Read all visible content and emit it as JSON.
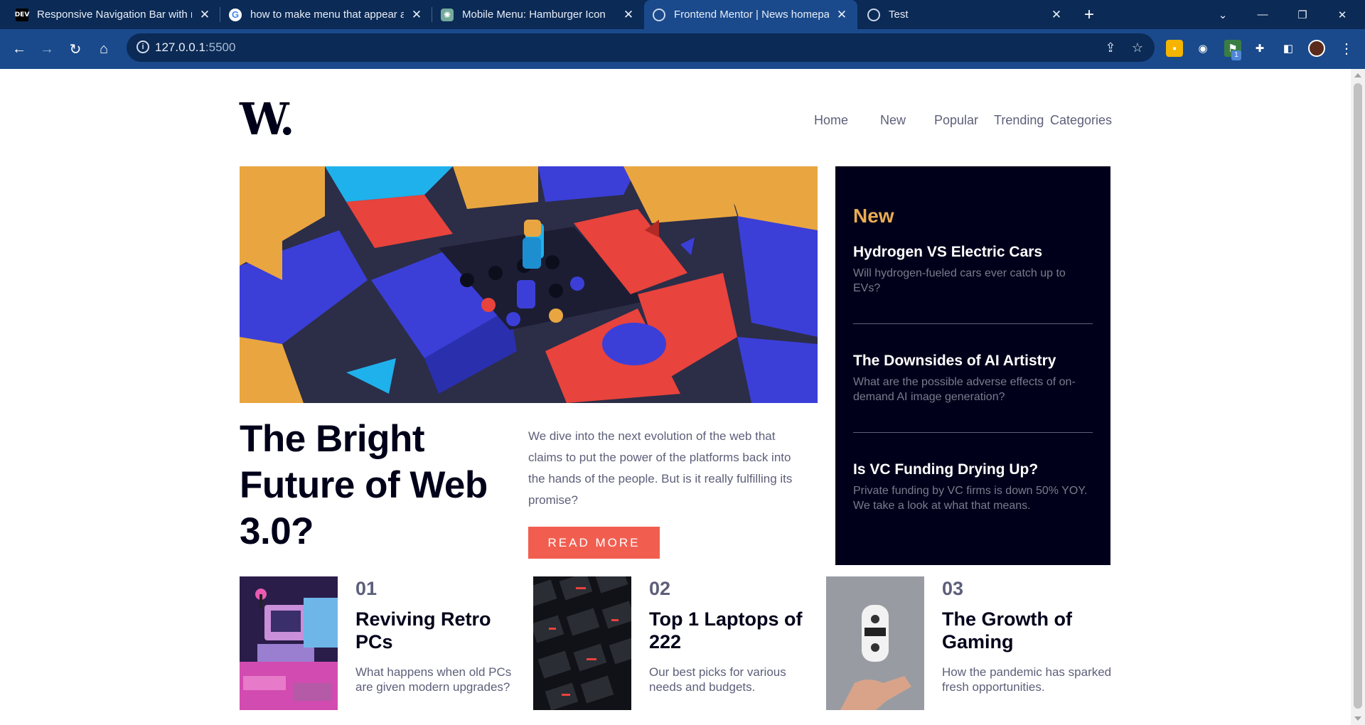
{
  "browser": {
    "tabs": [
      {
        "title": "Responsive Navigation Bar with n",
        "favicon": "dev-icon",
        "active": false
      },
      {
        "title": "how to make menu that appear a",
        "favicon": "google-icon",
        "active": false
      },
      {
        "title": "Mobile Menu: Hamburger Icon",
        "favicon": "chatgpt-icon",
        "active": false
      },
      {
        "title": "Frontend Mentor | News homepa",
        "favicon": "globe-icon",
        "active": true
      },
      {
        "title": "Test",
        "favicon": "globe-icon",
        "active": false
      }
    ],
    "url_host": "127.0.0.1",
    "url_port": ":5500",
    "extension_badge": "1"
  },
  "site": {
    "logo": "W.",
    "nav": [
      "Home",
      "New",
      "Popular",
      "Trending",
      "Categories"
    ],
    "hero": {
      "title": "The Bright Future of Web 3.0?",
      "text": "We dive into the next evolution of the web that claims to put the power of the platforms back into the hands of the people. But is it really fulfilling its promise?",
      "button": "READ MORE"
    },
    "new": {
      "heading": "New",
      "items": [
        {
          "title": "Hydrogen VS Electric Cars",
          "text": "Will hydrogen-fueled cars ever catch up to EVs?"
        },
        {
          "title": "The Downsides of AI Artistry",
          "text": "What are the possible adverse effects of on-demand AI image generation?"
        },
        {
          "title": "Is VC Funding Drying Up?",
          "text": "Private funding by VC firms is down 50% YOY. We take a look at what that means."
        }
      ]
    },
    "cards": [
      {
        "num": "01",
        "title": "Reviving Retro PCs",
        "text": "What happens when old PCs are given modern upgrades?"
      },
      {
        "num": "02",
        "title": "Top 1 Laptops of 222",
        "text": "Our best picks for various needs and budgets."
      },
      {
        "num": "03",
        "title": "The Growth of Gaming",
        "text": "How the pandemic has sparked fresh opportunities."
      }
    ]
  },
  "colors": {
    "accent_orange": "#e9ab53",
    "button_red": "#f15e50",
    "navy": "#00001a",
    "chrome_dark": "#0b2a55",
    "chrome_toolbar": "#1a4a8c"
  }
}
